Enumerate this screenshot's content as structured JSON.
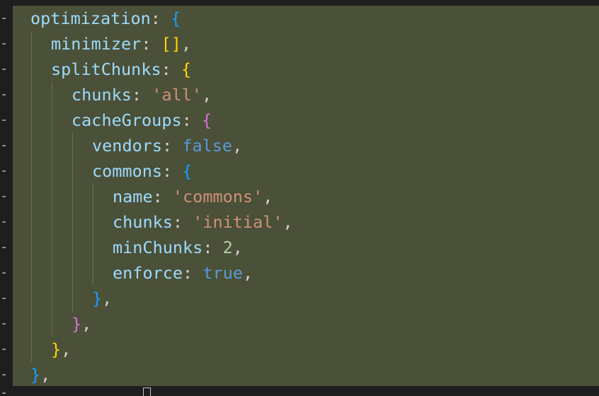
{
  "code": {
    "lines": [
      {
        "indent": 1,
        "tokens": [
          {
            "t": "optimization",
            "c": "key"
          },
          {
            "t": ": ",
            "c": "punct"
          },
          {
            "t": "{",
            "c": "b3"
          }
        ]
      },
      {
        "indent": 2,
        "tokens": [
          {
            "t": "minimizer",
            "c": "key"
          },
          {
            "t": ": ",
            "c": "punct"
          },
          {
            "t": "[]",
            "c": "b1"
          },
          {
            "t": ",",
            "c": "punct"
          }
        ]
      },
      {
        "indent": 2,
        "tokens": [
          {
            "t": "splitChunks",
            "c": "key"
          },
          {
            "t": ": ",
            "c": "punct"
          },
          {
            "t": "{",
            "c": "b1"
          }
        ]
      },
      {
        "indent": 3,
        "tokens": [
          {
            "t": "chunks",
            "c": "key"
          },
          {
            "t": ": ",
            "c": "punct"
          },
          {
            "t": "'all'",
            "c": "str"
          },
          {
            "t": ",",
            "c": "punct"
          }
        ]
      },
      {
        "indent": 3,
        "tokens": [
          {
            "t": "cacheGroups",
            "c": "key"
          },
          {
            "t": ": ",
            "c": "punct"
          },
          {
            "t": "{",
            "c": "b2"
          }
        ]
      },
      {
        "indent": 4,
        "tokens": [
          {
            "t": "vendors",
            "c": "key"
          },
          {
            "t": ": ",
            "c": "punct"
          },
          {
            "t": "false",
            "c": "kw"
          },
          {
            "t": ",",
            "c": "punct"
          }
        ]
      },
      {
        "indent": 4,
        "tokens": [
          {
            "t": "commons",
            "c": "key"
          },
          {
            "t": ": ",
            "c": "punct"
          },
          {
            "t": "{",
            "c": "b3"
          }
        ]
      },
      {
        "indent": 5,
        "tokens": [
          {
            "t": "name",
            "c": "key"
          },
          {
            "t": ": ",
            "c": "punct"
          },
          {
            "t": "'commons'",
            "c": "str"
          },
          {
            "t": ",",
            "c": "punct"
          }
        ]
      },
      {
        "indent": 5,
        "tokens": [
          {
            "t": "chunks",
            "c": "key"
          },
          {
            "t": ": ",
            "c": "punct"
          },
          {
            "t": "'initial'",
            "c": "str"
          },
          {
            "t": ",",
            "c": "punct"
          }
        ]
      },
      {
        "indent": 5,
        "tokens": [
          {
            "t": "minChunks",
            "c": "key"
          },
          {
            "t": ": ",
            "c": "punct"
          },
          {
            "t": "2",
            "c": "num"
          },
          {
            "t": ",",
            "c": "punct"
          }
        ]
      },
      {
        "indent": 5,
        "tokens": [
          {
            "t": "enforce",
            "c": "key"
          },
          {
            "t": ": ",
            "c": "punct"
          },
          {
            "t": "true",
            "c": "kw"
          },
          {
            "t": ",",
            "c": "punct"
          }
        ]
      },
      {
        "indent": 4,
        "tokens": [
          {
            "t": "}",
            "c": "b3"
          },
          {
            "t": ",",
            "c": "punct"
          }
        ]
      },
      {
        "indent": 3,
        "tokens": [
          {
            "t": "}",
            "c": "b2"
          },
          {
            "t": ",",
            "c": "punct"
          }
        ]
      },
      {
        "indent": 2,
        "tokens": [
          {
            "t": "}",
            "c": "b1"
          },
          {
            "t": ",",
            "c": "punct"
          }
        ]
      },
      {
        "indent": 1,
        "tokens": [
          {
            "t": "}",
            "c": "b3"
          },
          {
            "t": ",",
            "c": "punct"
          }
        ]
      }
    ],
    "trailing_fragment": "  {"
  },
  "colors": {
    "selection_background": "#4b5038",
    "editor_background": "#1e1e1e",
    "key": "#9cdcfe",
    "string": "#ce9178",
    "keyword": "#569cd6",
    "number": "#b5cea8",
    "bracket_level_1": "#ffd700",
    "bracket_level_2": "#da70d6",
    "bracket_level_3": "#179fff"
  }
}
